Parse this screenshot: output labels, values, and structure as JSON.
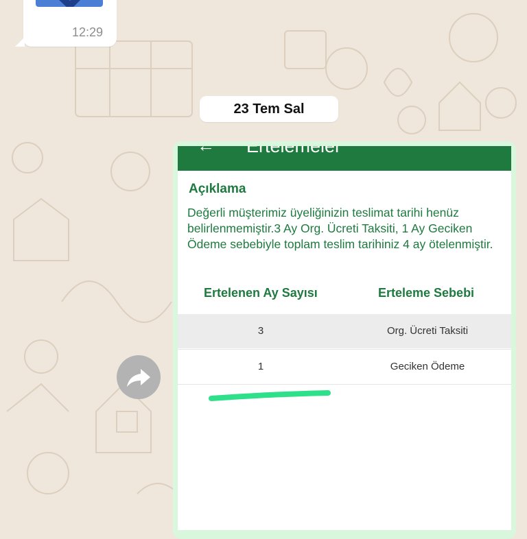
{
  "chat": {
    "previous_message_time": "12:29",
    "date_separator": "23 Tem Sal"
  },
  "screenshot": {
    "back_icon": "←",
    "title": "Ertelemeler",
    "section_title": "Açıklama",
    "description": "Değerli müşterimiz üyeliğinizin teslimat tarihi henüz belirlenmemiştir.3 Ay Org. Ücreti Taksiti, 1 Ay Geciken Ödeme sebebiyle toplam teslim tarihiniz 4 ay ötelenmiştir.",
    "table": {
      "headers": [
        "Ertelenen Ay Sayısı",
        "Erteleme Sebebi"
      ],
      "rows": [
        [
          "3",
          "Org. Ücreti Taksiti"
        ],
        [
          "1",
          "Geciken Ödeme"
        ]
      ]
    }
  },
  "colors": {
    "brand_green": "#1e7a3f",
    "highlight_marker": "#2fe08a",
    "wallpaper": "#efe7dc"
  }
}
